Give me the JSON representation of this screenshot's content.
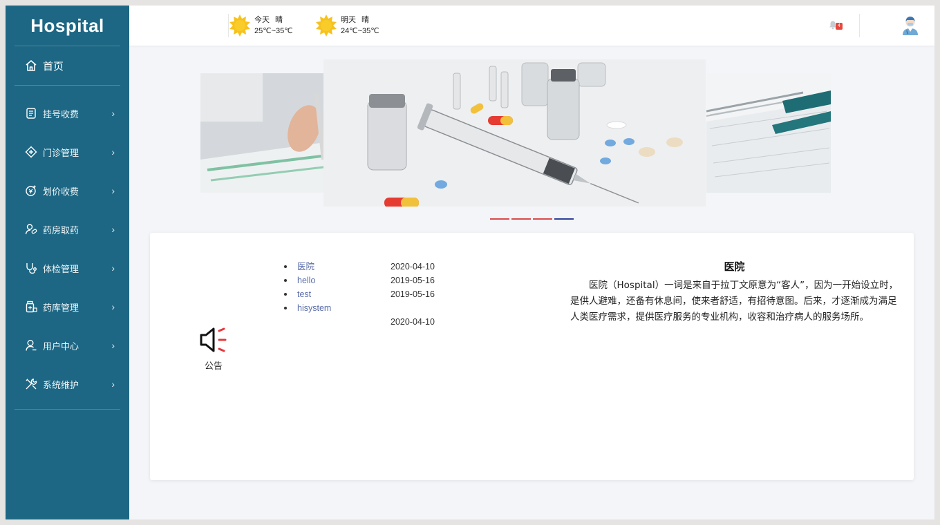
{
  "sidebar": {
    "logo": "Hospital",
    "home": "首页",
    "items": [
      {
        "label": "挂号收费",
        "icon": "register-icon"
      },
      {
        "label": "门诊管理",
        "icon": "clinic-icon"
      },
      {
        "label": "划价收费",
        "icon": "pricing-icon"
      },
      {
        "label": "药房取药",
        "icon": "pharmacy-icon"
      },
      {
        "label": "体检管理",
        "icon": "stethoscope-icon"
      },
      {
        "label": "药库管理",
        "icon": "drug-storage-icon"
      },
      {
        "label": "用户中心",
        "icon": "user-icon"
      },
      {
        "label": "系统维护",
        "icon": "tools-icon"
      }
    ]
  },
  "header": {
    "today": {
      "label": "今天",
      "condition": "晴",
      "temp": "25℃~35℃"
    },
    "tomorrow": {
      "label": "明天",
      "condition": "晴",
      "temp": "24℃~35℃"
    },
    "notification_count": "4"
  },
  "notice": {
    "label": "公告",
    "items": [
      {
        "title": "医院",
        "date": "2020-04-10"
      },
      {
        "title": "hello",
        "date": "2019-05-16"
      },
      {
        "title": "test",
        "date": "2019-05-16"
      },
      {
        "title": "hisystem",
        "date": "2020-04-10"
      }
    ],
    "article_title": "医院",
    "article_body": "医院（Hospital）一词是来自于拉丁文原意为“客人”，因为一开始设立时，是供人避难，还备有休息间，使来者舒适，有招待意图。后来，才逐渐成为满足人类医疗需求，提供医疗服务的专业机构，收容和治疗病人的服务场所。"
  },
  "colors": {
    "sidebar_bg": "#1d6784",
    "link": "#5c6ea8",
    "dot_inactive": "#d94a4a",
    "dot_active": "#2f3f9c"
  }
}
